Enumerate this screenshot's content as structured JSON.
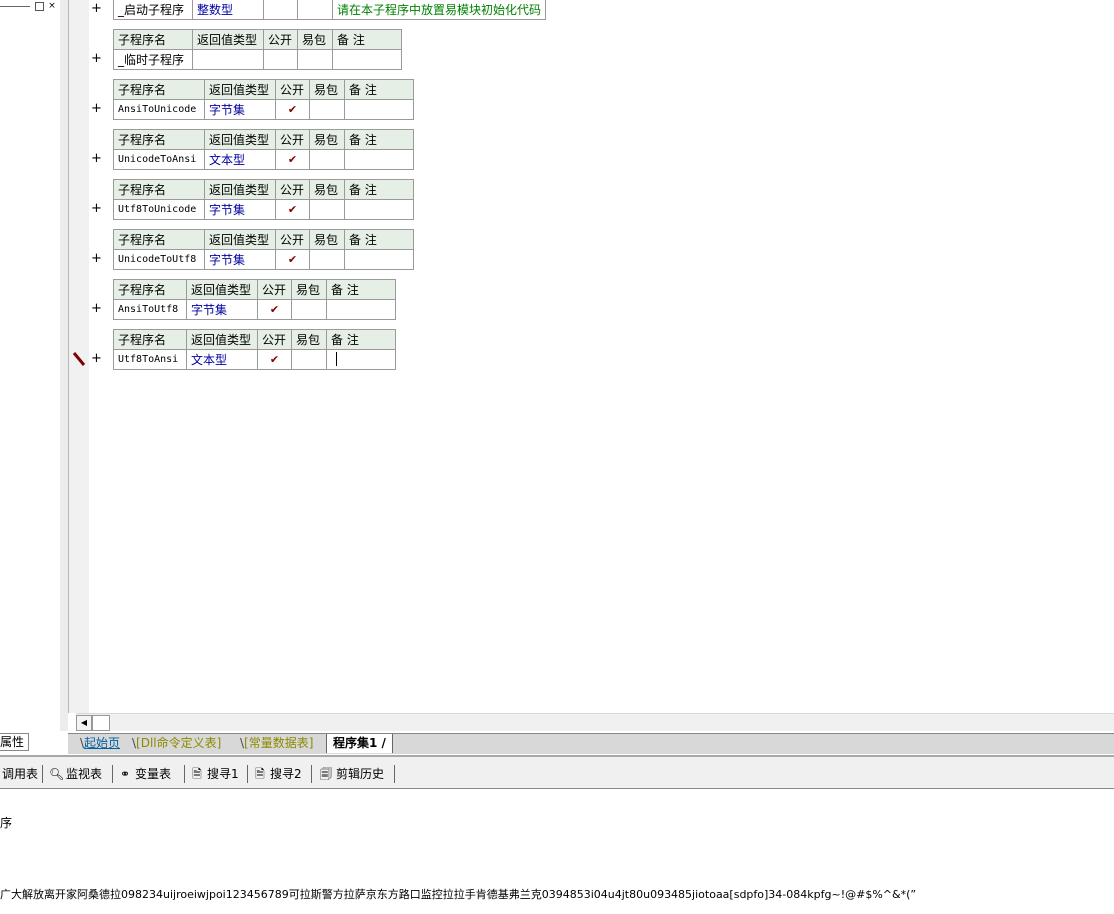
{
  "left_pane": {
    "close_glyph": "×",
    "restore_glyph": "▫",
    "properties_tab": "属性"
  },
  "header": {
    "columns": [
      "子程序名",
      "返回值类型",
      "公开",
      "易包",
      "备 注"
    ]
  },
  "subroutines": [
    {
      "name": "_启动子程序",
      "return_type": "整数型",
      "public": "",
      "easy_pack": "",
      "remark": "请在本子程序中放置易模块初始化代码",
      "header_visible": false
    },
    {
      "name": "_临时子程序",
      "return_type": "",
      "public": "",
      "easy_pack": "",
      "remark": "",
      "header_visible": true
    },
    {
      "name": "AnsiToUnicode",
      "return_type": "字节集",
      "public": "✔",
      "easy_pack": "",
      "remark": "",
      "header_visible": true
    },
    {
      "name": "UnicodeToAnsi",
      "return_type": "文本型",
      "public": "✔",
      "easy_pack": "",
      "remark": "",
      "header_visible": true
    },
    {
      "name": "Utf8ToUnicode",
      "return_type": "字节集",
      "public": "✔",
      "easy_pack": "",
      "remark": "",
      "header_visible": true
    },
    {
      "name": "UnicodeToUtf8",
      "return_type": "字节集",
      "public": "✔",
      "easy_pack": "",
      "remark": "",
      "header_visible": true
    },
    {
      "name": "AnsiToUtf8",
      "return_type": "字节集",
      "public": "✔",
      "easy_pack": "",
      "remark": "",
      "header_visible": true
    },
    {
      "name": "Utf8ToAnsi",
      "return_type": "文本型",
      "public": "✔",
      "easy_pack": "",
      "remark": "",
      "header_visible": true
    }
  ],
  "expand_glyph": "+",
  "tabs": [
    {
      "label": "起始页",
      "color": "#0060a0"
    },
    {
      "label": "[Dll命令定义表]",
      "color": "#8a8a00"
    },
    {
      "label": "[常量数据表]",
      "color": "#8a8a00"
    },
    {
      "label": "程序集1",
      "color": "#000000",
      "active": true
    }
  ],
  "toolbar": {
    "items": [
      {
        "label": "调用表",
        "icon": "call-table-icon"
      },
      {
        "label": "监视表",
        "icon": "magnifier-icon"
      },
      {
        "label": "变量表",
        "icon": "variables-icon"
      },
      {
        "label": "搜寻1",
        "icon": "search-doc-icon"
      },
      {
        "label": "搜寻2",
        "icon": "search-doc-icon"
      },
      {
        "label": "剪辑历史",
        "icon": "clipboard-history-icon"
      }
    ]
  },
  "output": {
    "line1": "序",
    "line2": "广大解放离开家阿桑德拉098234uijroeiwjpoi123456789可拉斯警方拉萨京东方路口监控拉拉手肯德基弗兰克0394853i04u4jt80u093485jiotoaa[sdpfo]34-084kpfg~!@#$%^&*(”"
  },
  "colors": {
    "header_bg": "#e6efe6",
    "type_text": "#0000a0",
    "remark_text": "#008000",
    "check": "#800000"
  }
}
